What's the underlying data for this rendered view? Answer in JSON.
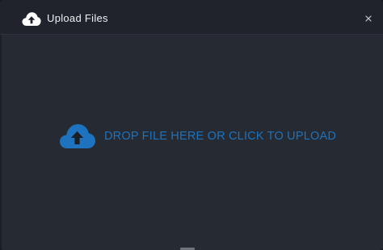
{
  "dialog": {
    "title": "Upload Files",
    "title_icon": "cloud-upload-icon",
    "close_icon": "close-icon"
  },
  "dropzone": {
    "label": "DROP FILE HERE OR CLICK TO UPLOAD",
    "icon": "cloud-upload-icon"
  },
  "colors": {
    "dialog_background": "#262a33",
    "titlebar_background": "#20232b",
    "title_text": "#eef0f4",
    "accent": "#1e73be"
  }
}
